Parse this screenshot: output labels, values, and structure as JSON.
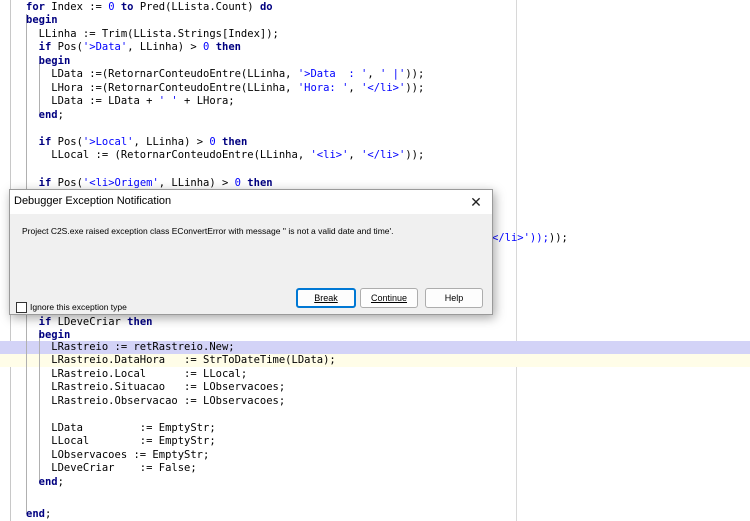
{
  "code_lines": [
    "for Index := 0 to Pred(LLista.Count) do",
    "begin",
    "  LLinha := Trim(LLista.Strings[Index]);",
    "  if Pos('>Data', LLinha) > 0 then",
    "  begin",
    "    LData :=(RetornarConteudoEntre(LLinha, '>Data  : ', ' |'));",
    "    LHora :=(RetornarConteudoEntre(LLinha, 'Hora: ', '</li>'));",
    "    LData := LData + ' ' + LHora;",
    "  end;",
    "",
    "  if Pos('>Local', LLinha) > 0 then",
    "    LLocal := (RetornarConteudoEntre(LLinha, '<li>', '</li>'));",
    "",
    "  if Pos('<li>Origem', LLinha) > 0 then",
    "  if LDeveCriar then",
    "  begin",
    "    LRastreio := retRastreio.New;",
    "    LRastreio.DataHora   := StrToDateTime(LData);",
    "    LRastreio.Local      := LLocal;",
    "    LRastreio.Situacao   := LObservacoes;",
    "    LRastreio.Observacao := LObservacoes;",
    "",
    "    LData         := EmptyStr;",
    "    LLocal        := EmptyStr;",
    "    LObservacoes := EmptyStr;",
    "    LDeveCriar    := False;",
    "  end;",
    "",
    "end;"
  ],
  "hidden_line_fragment": "</li>'));",
  "dialog": {
    "title": "Debugger Exception Notification",
    "close_icon": "close-icon",
    "message": "Project C2S.exe raised exception class EConvertError with message '' is not a valid date and time'.",
    "checkbox_label": "Ignore this exception type",
    "checkbox_checked": false,
    "buttons": {
      "break": "Break",
      "continue": "Continue",
      "help": "Help"
    }
  },
  "colors": {
    "keyword": "#000080",
    "string": "#0000ff",
    "execution_line": "#d3d3f7",
    "dialog_default_border": "#0078d4"
  }
}
